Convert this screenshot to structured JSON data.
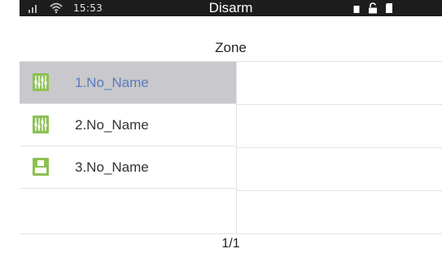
{
  "status": {
    "time": "15:53",
    "mode": "Disarm"
  },
  "title": "Zone",
  "zones": [
    {
      "label": "1.No_Name",
      "icon": "curtain-sensor-icon",
      "selected": true
    },
    {
      "label": "2.No_Name",
      "icon": "curtain-sensor-icon",
      "selected": false
    },
    {
      "label": "3.No_Name",
      "icon": "door-sensor-icon",
      "selected": false
    }
  ],
  "pager": "1/1",
  "colors": {
    "status_bar": "#1d1d1d",
    "selected_row": "#c9c8cc",
    "selected_text": "#5b7dc0",
    "icon_green": "#8cc152"
  }
}
